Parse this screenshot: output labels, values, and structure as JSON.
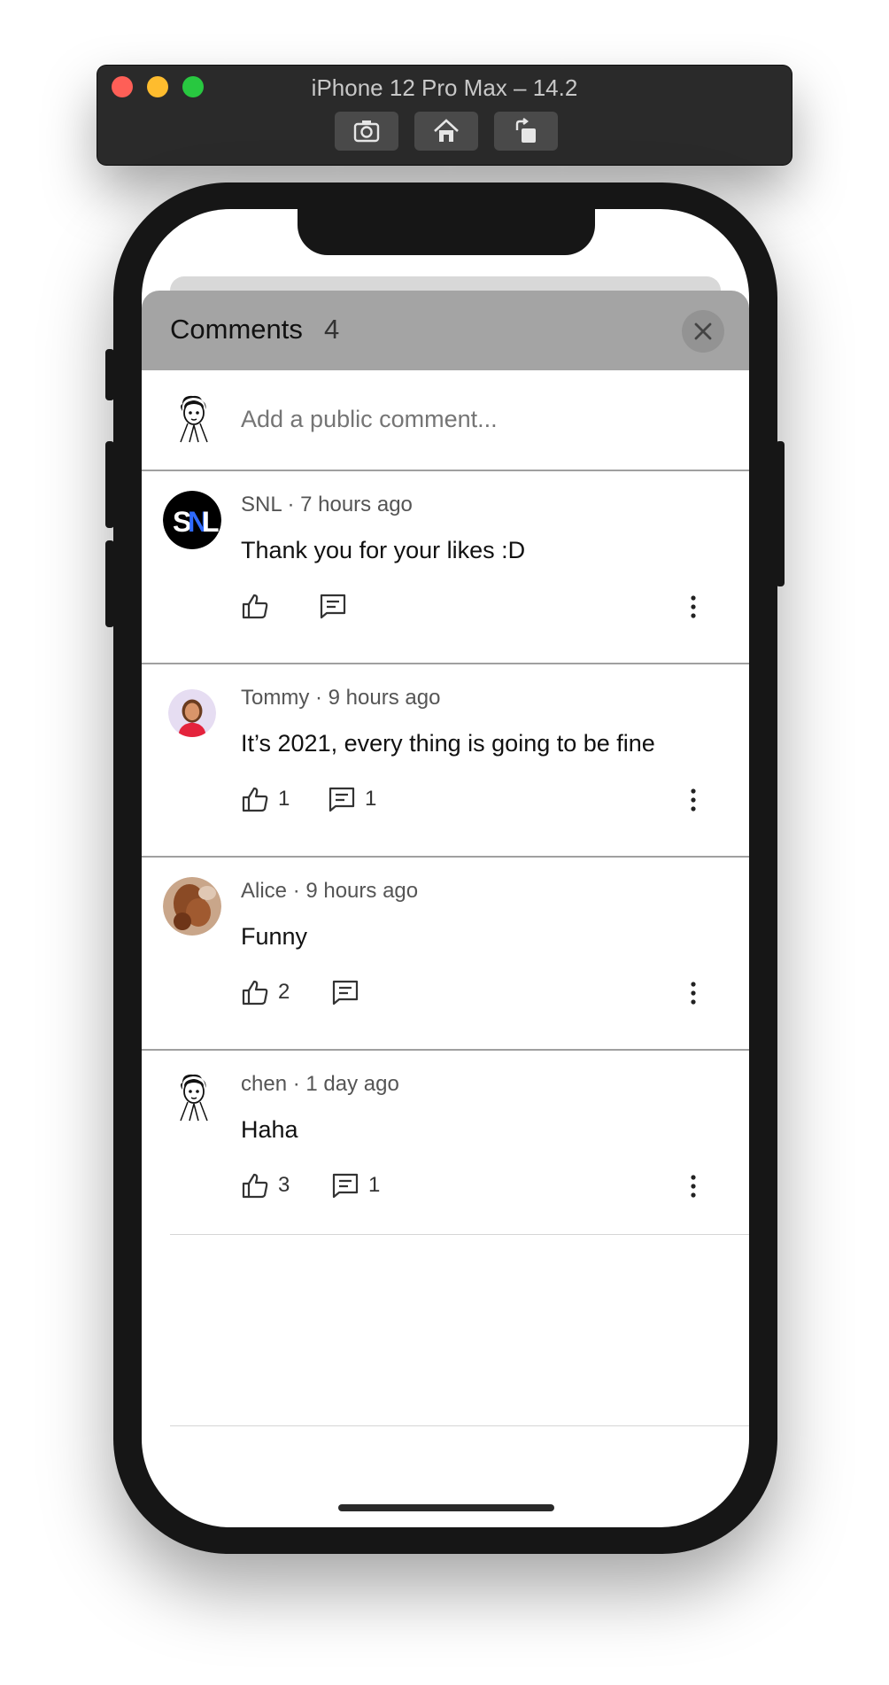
{
  "simulator": {
    "title": "iPhone 12 Pro Max – 14.2",
    "buttons": [
      "screenshot-icon",
      "home-icon",
      "rotate-icon"
    ]
  },
  "sheet": {
    "title": "Comments",
    "count": "4",
    "close_icon": "close-icon"
  },
  "compose": {
    "placeholder": "Add a public comment..."
  },
  "comments": [
    {
      "author": "SNL",
      "meta": "SNL · 7 hours ago",
      "text": "Thank you for your likes :D",
      "likes": "",
      "replies": ""
    },
    {
      "author": "Tommy",
      "meta": "Tommy · 9 hours ago",
      "text": "It’s 2021, every thing is going to be fine",
      "likes": "1",
      "replies": "1"
    },
    {
      "author": "Alice",
      "meta": "Alice · 9 hours ago",
      "text": "Funny",
      "likes": "2",
      "replies": ""
    },
    {
      "author": "chen",
      "meta": "chen · 1 day ago",
      "text": "Haha",
      "likes": "3",
      "replies": "1"
    }
  ],
  "colors": {
    "header": "#a4a4a4",
    "divider": "#a0a0a0",
    "phone_frame": "#161616"
  }
}
